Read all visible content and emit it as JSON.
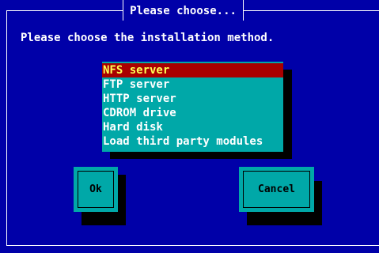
{
  "dialog": {
    "title": "Please choose...",
    "prompt": "Please choose the installation method."
  },
  "methods": {
    "items": [
      {
        "label": "NFS server",
        "selected": true
      },
      {
        "label": "FTP server",
        "selected": false
      },
      {
        "label": "HTTP server",
        "selected": false
      },
      {
        "label": "CDROM drive",
        "selected": false
      },
      {
        "label": "Hard disk",
        "selected": false
      },
      {
        "label": "Load third party modules",
        "selected": false
      }
    ]
  },
  "buttons": {
    "ok_label": "Ok",
    "cancel_label": "Cancel"
  },
  "colors": {
    "background": "#0000a8",
    "list_background": "#00a8a8",
    "selected_background": "#a80000",
    "selected_text": "#ffff55",
    "shadow": "#000000"
  }
}
